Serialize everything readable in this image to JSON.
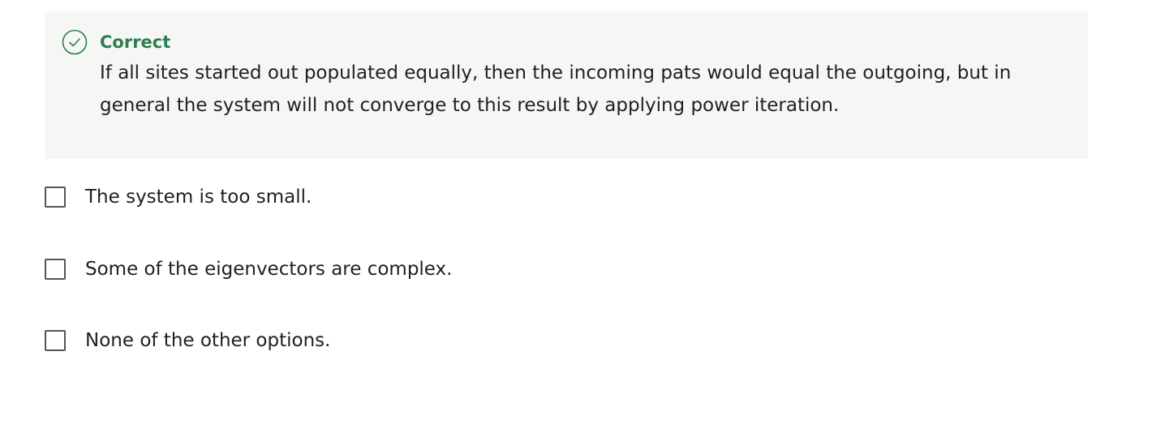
{
  "feedback": {
    "status_icon": "check-circle-icon",
    "title": "Correct",
    "text": "If all sites started out populated equally, then the incoming pats would equal the outgoing, but in general the system will not converge to this result by applying power iteration.",
    "colors": {
      "title": "#2e7d4f",
      "background": "#f5f7f5"
    }
  },
  "options": [
    {
      "label": "The system is too small.",
      "checked": false
    },
    {
      "label": "Some of the eigenvectors are complex.",
      "checked": false
    },
    {
      "label": "None of the other options.",
      "checked": false
    }
  ]
}
